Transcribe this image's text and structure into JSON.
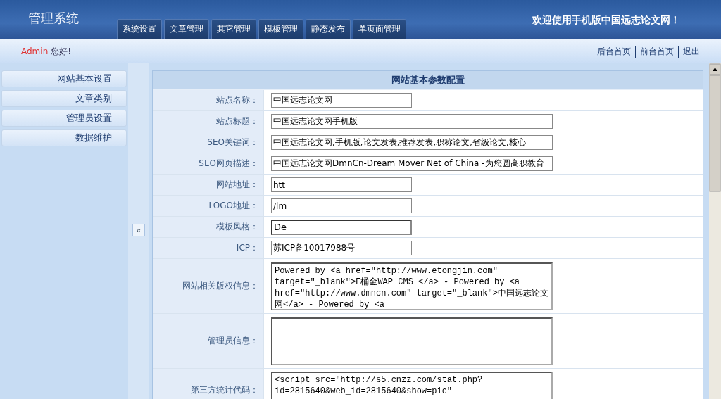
{
  "header": {
    "title": "管理系统",
    "welcome": "欢迎使用手机版中国远志论文网！"
  },
  "nav_tabs": [
    "系统设置",
    "文章管理",
    "其它管理",
    "模板管理",
    "静态发布",
    "单页面管理"
  ],
  "user_bar": {
    "user": "Admin",
    "greeting": "您好!",
    "links": [
      "后台首页",
      "前台首页",
      "退出"
    ]
  },
  "sidebar": {
    "items": [
      "网站基本设置",
      "文章类别",
      "管理员设置",
      "数据维护"
    ],
    "toggle": "«"
  },
  "form": {
    "title": "网站基本参数配置",
    "rows": [
      {
        "label": "站点名称：",
        "kind": "short",
        "value": "中国远志论文网"
      },
      {
        "label": "站点标题：",
        "kind": "long",
        "value": "中国远志论文网手机版"
      },
      {
        "label": "SEO关键词：",
        "kind": "long",
        "value": "中国远志论文网,手机版,论文发表,推荐发表,职称论文,省级论文,核心"
      },
      {
        "label": "SEO网页描述：",
        "kind": "long",
        "value": "中国远志论文网DmnCn-Dream Mover Net of China -为您圆高职教育"
      },
      {
        "label": "网站地址：",
        "kind": "short",
        "value": "htt"
      },
      {
        "label": "LOGO地址：",
        "kind": "short",
        "value": "/lm"
      },
      {
        "label": "模板风格：",
        "kind": "select",
        "value": "De"
      },
      {
        "label": "ICP：",
        "kind": "short",
        "value": "苏ICP备10017988号"
      },
      {
        "label": "网站相关版权信息：",
        "kind": "textarea",
        "value": "Powered by <a href=\"http://www.etongjin.com\" target=\"_blank\">E桶金WAP CMS </a> - Powered by <a href=\"http://www.dmncn.com\" target=\"_blank\">中国远志论文网</a> - Powered by <a"
      },
      {
        "label": "管理员信息：",
        "kind": "textarea",
        "value": ""
      },
      {
        "label": "第三方统计代码：",
        "kind": "textarea",
        "value": "<script src=\"http://s5.cnzz.com/stat.php?id=2815640&web_id=2815640&show=pic\""
      }
    ]
  }
}
